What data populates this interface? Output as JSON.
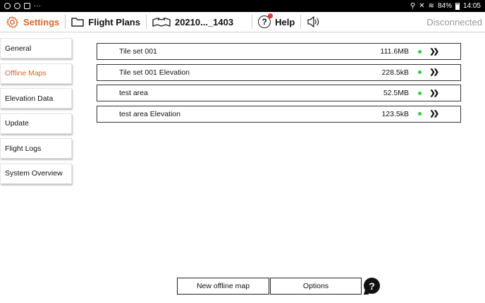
{
  "statusbar": {
    "battery": "84%",
    "time": "14:05"
  },
  "topbar": {
    "settings_label": "Settings",
    "flight_plans_label": "Flight Plans",
    "flight_name": "20210..._1403",
    "help_label": "Help",
    "connection_status": "Disconnected",
    "accent_color": "#d9662b"
  },
  "sidebar": {
    "items": [
      {
        "label": "General"
      },
      {
        "label": "Offline Maps"
      },
      {
        "label": "Elevation Data"
      },
      {
        "label": "Update"
      },
      {
        "label": "Flight Logs"
      },
      {
        "label": "System Overview"
      }
    ],
    "active_index": 1
  },
  "tiles": [
    {
      "name": "Tile set 001",
      "size": "111.6MB",
      "status_color": "#2ecc40",
      "action_icon": "double-chevron-right"
    },
    {
      "name": "Tile set 001 Elevation",
      "size": "228.5kB",
      "status_color": "#2ecc40",
      "action_icon": "double-chevron-right"
    },
    {
      "name": "test area",
      "size": "52.5MB",
      "status_color": "#2ecc40",
      "action_icon": "double-chevron-right"
    },
    {
      "name": "test area Elevation",
      "size": "123.5kB",
      "status_color": "#2ecc40",
      "action_icon": "double-chevron-right"
    }
  ],
  "buttons": {
    "new_offline_map": "New offline map",
    "options": "Options",
    "help_glyph": "?"
  }
}
